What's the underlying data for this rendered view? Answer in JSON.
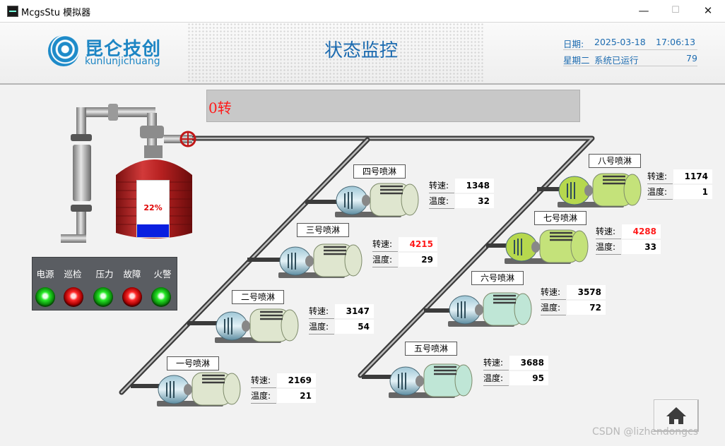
{
  "window": {
    "title": "McgsStu 模拟器",
    "min": "—",
    "max": "☐",
    "close": "✕"
  },
  "header": {
    "logo_cn": "昆仑技创",
    "logo_en": "kunlunjichuang",
    "title": "状态监控",
    "date_label": "日期:",
    "date": "2025-03-18",
    "time": "17:06:13",
    "weekday": "星期二",
    "runtime_label": "系统已运行",
    "runtime": "79"
  },
  "status": {
    "text": "0转"
  },
  "tank": {
    "level_text": "22%",
    "level": 0.22
  },
  "panel": {
    "lamps": [
      {
        "label": "电源",
        "state": "green"
      },
      {
        "label": "巡检",
        "state": "red"
      },
      {
        "label": "压力",
        "state": "green"
      },
      {
        "label": "故障",
        "state": "red"
      },
      {
        "label": "火警",
        "state": "green"
      }
    ]
  },
  "readout_labels": {
    "speed": "转速:",
    "temp": "温度:"
  },
  "sprinklers": [
    {
      "name": "一号喷淋",
      "speed": "2169",
      "temp": "21",
      "alarm": false,
      "motor_color": "#dfe6cf"
    },
    {
      "name": "二号喷淋",
      "speed": "3147",
      "temp": "54",
      "alarm": false,
      "motor_color": "#dfe6cf"
    },
    {
      "name": "三号喷淋",
      "speed": "4215",
      "temp": "29",
      "alarm": true,
      "motor_color": "#dfe6cf"
    },
    {
      "name": "四号喷淋",
      "speed": "1348",
      "temp": "32",
      "alarm": false,
      "motor_color": "#dfe6cf"
    },
    {
      "name": "五号喷淋",
      "speed": "3688",
      "temp": "95",
      "alarm": false,
      "motor_color": "#bfe6d6"
    },
    {
      "name": "六号喷淋",
      "speed": "3578",
      "temp": "72",
      "alarm": false,
      "motor_color": "#bfe6d6"
    },
    {
      "name": "七号喷淋",
      "speed": "4288",
      "temp": "33",
      "alarm": true,
      "motor_color": "#c4e27a"
    },
    {
      "name": "八号喷淋",
      "speed": "1174",
      "temp": "1",
      "alarm": false,
      "motor_color": "#c4e27a"
    }
  ],
  "watermark": "CSDN @lizhendongcs",
  "home": {
    "icon": "home-icon"
  }
}
